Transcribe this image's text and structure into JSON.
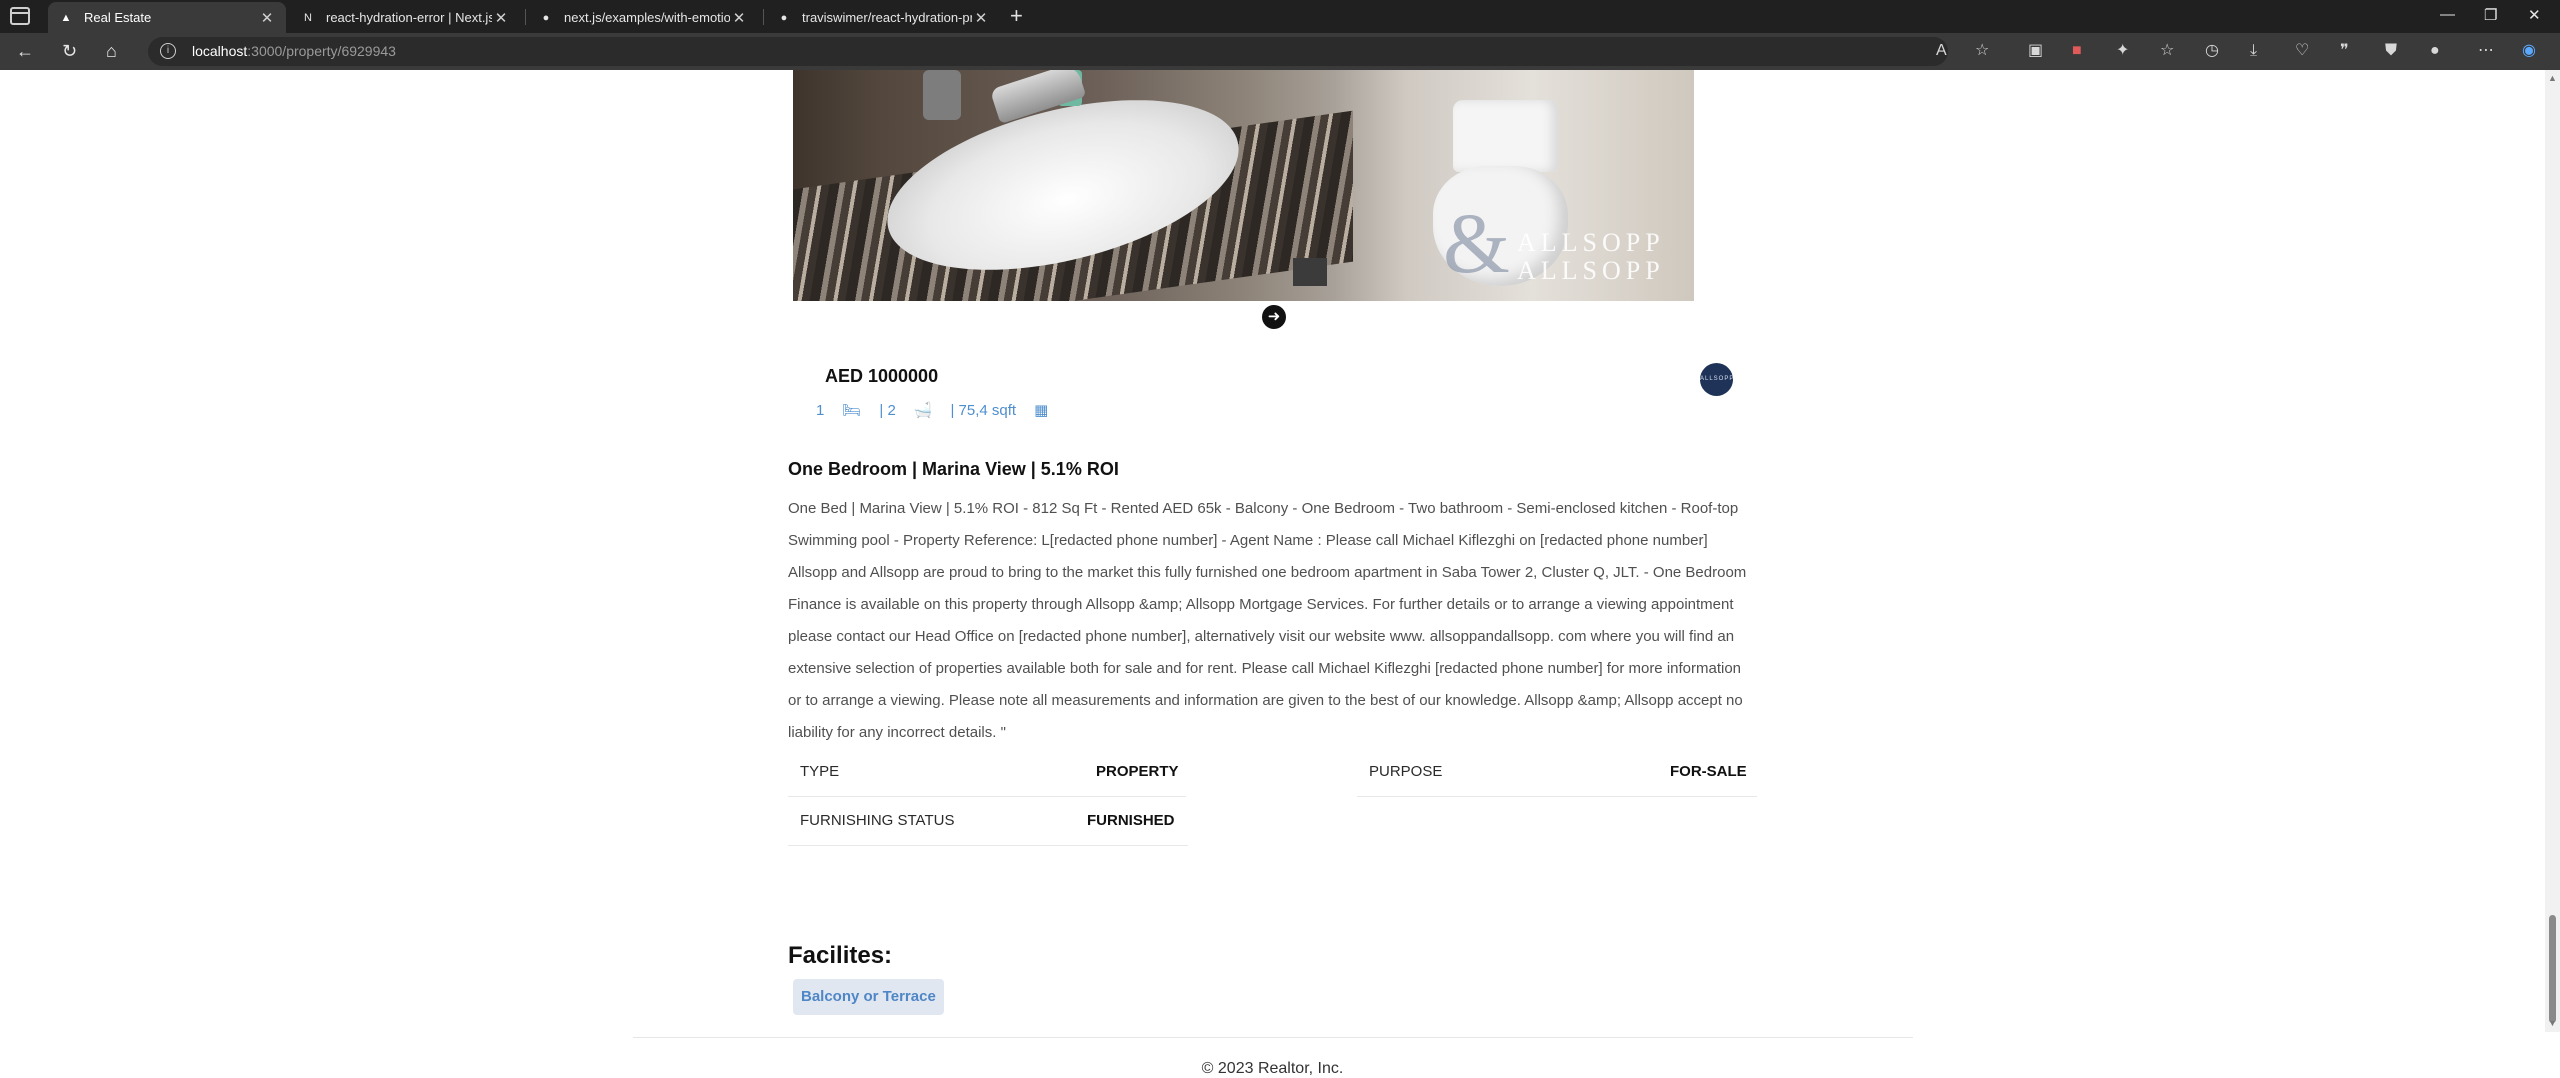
{
  "browser": {
    "tabs": [
      {
        "title": "Real Estate",
        "favicon": "triangle-icon",
        "active": true
      },
      {
        "title": "react-hydration-error | Next.js",
        "favicon": "nextjs-icon",
        "active": false
      },
      {
        "title": "next.js/examples/with-emotion a",
        "favicon": "github-icon",
        "active": false
      },
      {
        "title": "traviswimer/react-hydration-pro",
        "favicon": "github-icon",
        "active": false
      }
    ],
    "url_host": "localhost",
    "url_path": ":3000/property/6929943"
  },
  "property": {
    "photo_watermark": [
      "ALLSOPP",
      "ALLSOPP"
    ],
    "price": "AED 1000000",
    "agency_logo_text": "ALLSOPP",
    "rooms": "1",
    "baths": "| 2",
    "area": "| 75,4 sqft",
    "title": "One Bedroom | Marina View | 5.1% ROI",
    "description": "One Bed | Marina View | 5.1% ROI - 812 Sq Ft - Rented AED 65k - Balcony - One Bedroom - Two bathroom - Semi-enclosed kitchen - Roof-top Swimming pool - Property Reference: L[redacted phone number] - Agent Name : Please call Michael Kiflezghi on [redacted phone number] Allsopp and Allsopp are proud to bring to the market this fully furnished one bedroom apartment in Saba Tower 2, Cluster Q, JLT. - One Bedroom Finance is available on this property through Allsopp &amp; Allsopp Mortgage Services. For further details or to arrange a viewing appointment please contact our Head Office on [redacted phone number], alternatively visit our website www. allsoppandallsopp. com where you will find an extensive selection of properties available both for sale and for rent. Please call Michael Kiflezghi [redacted phone number] for more information or to arrange a viewing. Please note all measurements and information are given to the best of our knowledge. Allsopp &amp; Allsopp accept no liability for any incorrect details. \"",
    "attributes": {
      "type_label": "TYPE",
      "type_value": "PROPERTY",
      "purpose_label": "PURPOSE",
      "purpose_value": "FOR-SALE",
      "furnishing_label": "FURNISHING STATUS",
      "furnishing_value": "FURNISHED"
    },
    "facilities_title": "Facilites:",
    "facilities": [
      "Balcony or Terrace"
    ]
  },
  "footer": {
    "copyright": "© 2023 Realtor, Inc."
  },
  "colors": {
    "accent": "#4f8fce",
    "chip_bg": "#e1e7f1",
    "chrome_dark": "#202020"
  }
}
